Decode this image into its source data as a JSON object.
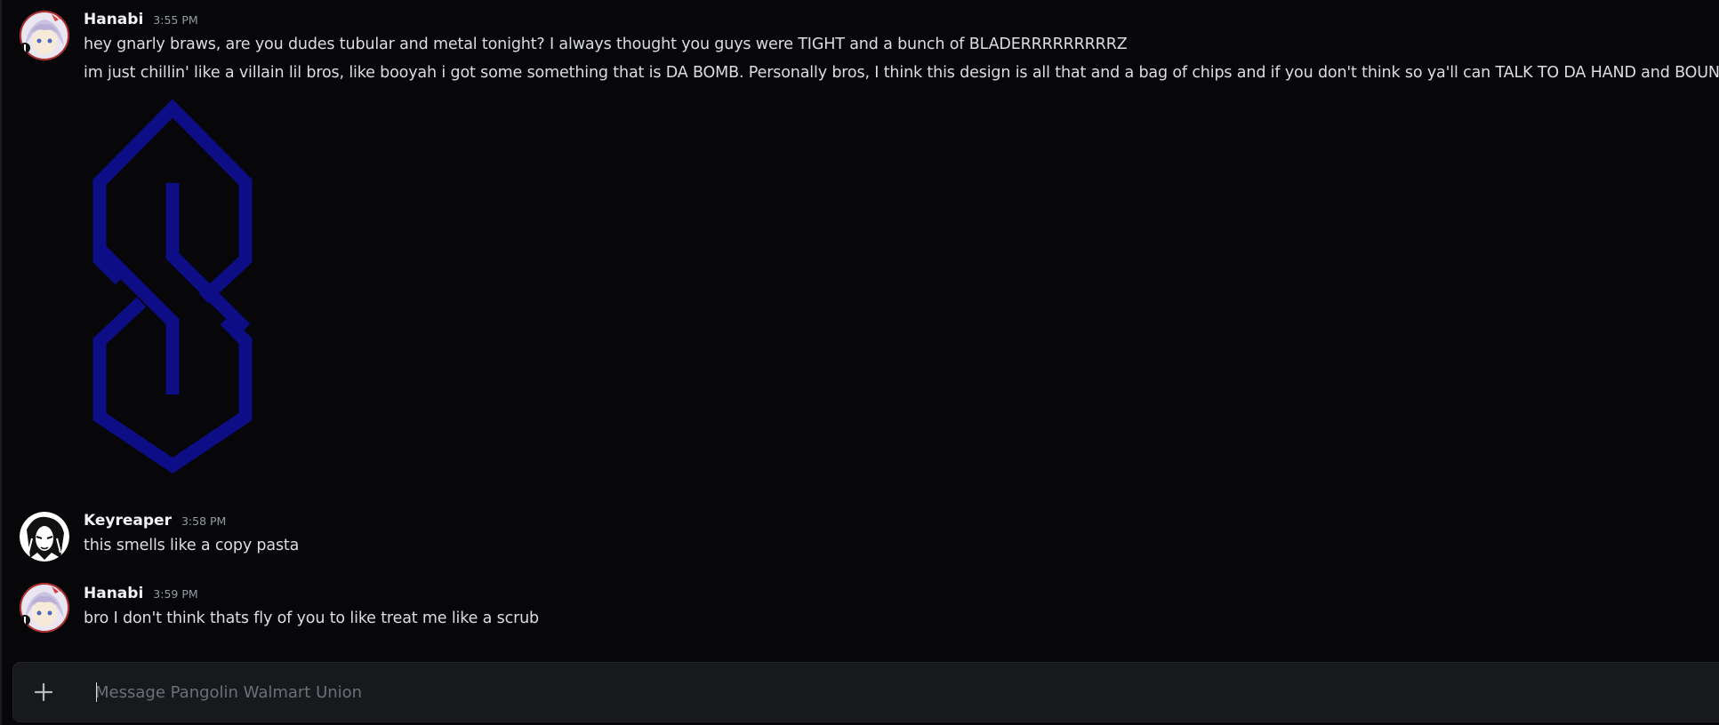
{
  "messages": [
    {
      "author": "Hanabi",
      "time": "3:55 PM",
      "lines": [
        "hey gnarly braws, are you dudes tubular and metal tonight? I always thought you guys were TIGHT and a bunch of BLADERRRRRRRRRZ",
        "im just chillin' like a villain lil bros, like booyah i got some something that is DA BOMB. Personally bros, I think this design is all that and a bag of chips and if you don't think so ya'll can TALK TO DA HAND and BOUNCE"
      ],
      "attachment_icon": "blue-s-logo-icon"
    },
    {
      "author": "Keyreaper",
      "time": "3:58 PM",
      "lines": [
        "this smells like a copy pasta"
      ]
    },
    {
      "author": "Hanabi",
      "time": "3:59 PM",
      "lines": [
        "bro I don't think thats fly of you to like treat me like a scrub"
      ]
    }
  ],
  "composer": {
    "placeholder": "Message Pangolin Walmart Union",
    "value": "",
    "plus_icon": "plus-icon"
  },
  "colors": {
    "background": "#070709",
    "logo_blue": "#0d0d85",
    "text": "#dbdee1",
    "muted": "#949ba4"
  }
}
